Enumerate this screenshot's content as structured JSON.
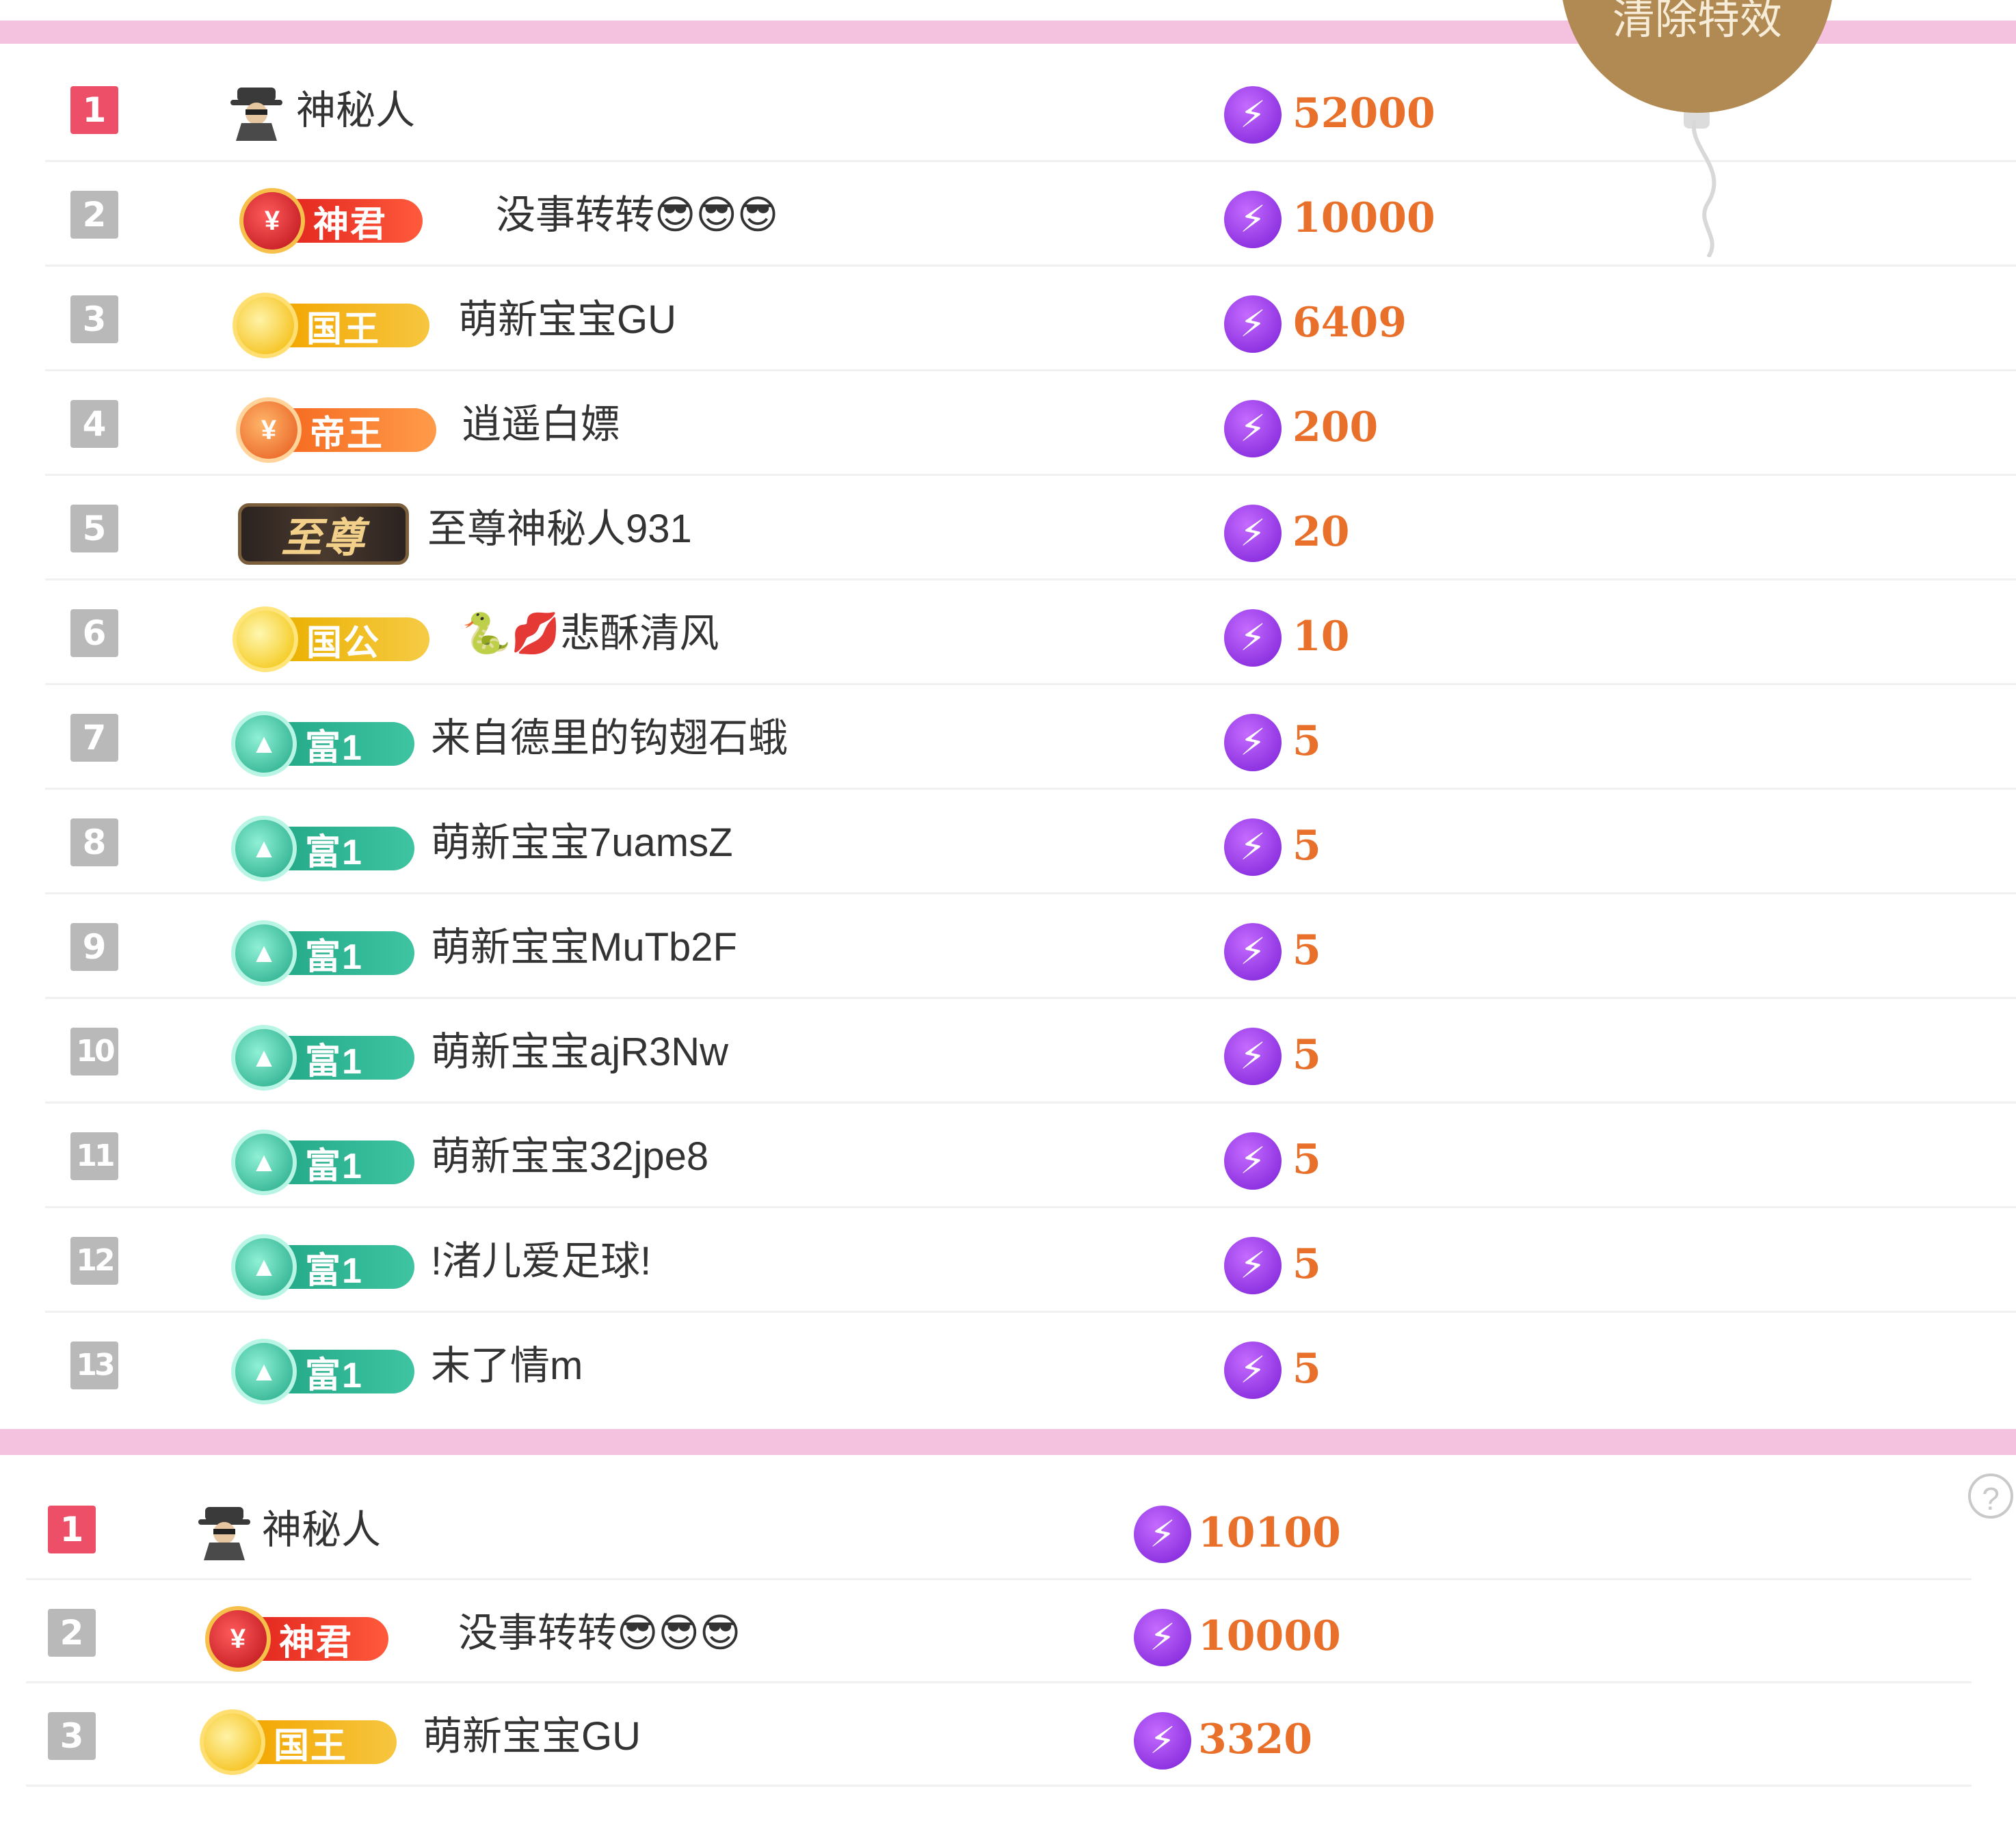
{
  "clear_effects_label": "清除特效",
  "leaderboard_top": [
    {
      "rank": "1",
      "badge": null,
      "name": "神秘人",
      "score": "52000"
    },
    {
      "rank": "2",
      "badge": "神君",
      "name": "没事转转😎😎😎",
      "score": "10000"
    },
    {
      "rank": "3",
      "badge": "国王",
      "name": "萌新宝宝GU",
      "score": "6409"
    },
    {
      "rank": "4",
      "badge": "帝王",
      "name": "逍遥白嫖",
      "score": "200"
    },
    {
      "rank": "5",
      "badge": "至尊",
      "name": "至尊神秘人931",
      "score": "20"
    },
    {
      "rank": "6",
      "badge": "国公",
      "name": "🐍💋悲酥清风",
      "score": "10"
    },
    {
      "rank": "7",
      "badge": "富1",
      "name": "来自德里的钩翅石蛾",
      "score": "5"
    },
    {
      "rank": "8",
      "badge": "富1",
      "name": "萌新宝宝7uamsZ",
      "score": "5"
    },
    {
      "rank": "9",
      "badge": "富1",
      "name": "萌新宝宝MuTb2F",
      "score": "5"
    },
    {
      "rank": "10",
      "badge": "富1",
      "name": "萌新宝宝ajR3Nw",
      "score": "5"
    },
    {
      "rank": "11",
      "badge": "富1",
      "name": "萌新宝宝32jpe8",
      "score": "5"
    },
    {
      "rank": "12",
      "badge": "富1",
      "name": "!渚儿爱足球!",
      "score": "5"
    },
    {
      "rank": "13",
      "badge": "富1",
      "name": "末了情m",
      "score": "5"
    }
  ],
  "leaderboard_bottom": [
    {
      "rank": "1",
      "badge": null,
      "name": "神秘人",
      "score": "10100"
    },
    {
      "rank": "2",
      "badge": "神君",
      "name": "没事转转😎😎😎",
      "score": "10000"
    },
    {
      "rank": "3",
      "badge": "国王",
      "name": "萌新宝宝GU",
      "score": "3320"
    }
  ],
  "help_label": "?",
  "colors": {
    "pink_bar": "#f4c1df",
    "rank_first": "#ee4f68",
    "rank_other": "#b9b9b9",
    "score": "#e8702a",
    "balloon": "#b08a52"
  },
  "icons": {
    "anonymous": "spy-icon",
    "score": "lightning-bolt-icon",
    "help": "question-mark-icon"
  }
}
